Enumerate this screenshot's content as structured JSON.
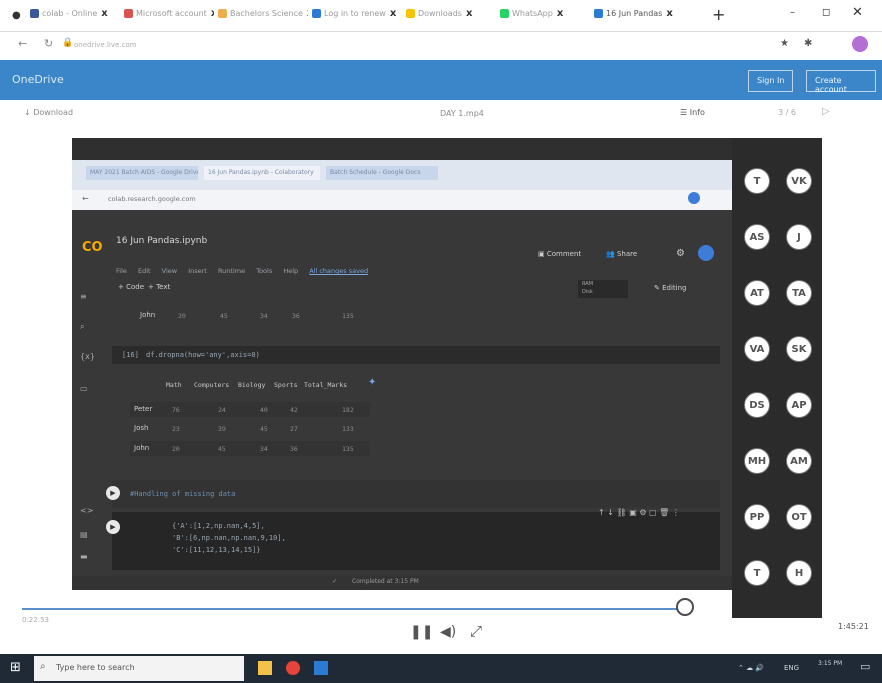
{
  "browser_tabs": [
    {
      "label": "colab - Online",
      "color": "#3b5998"
    },
    {
      "label": "Microsoft account",
      "color": "#d9534f"
    },
    {
      "label": "Bachelors Science",
      "color": "#f0ad4e"
    },
    {
      "label": "Log in to renew",
      "color": "#2b7bd3"
    },
    {
      "label": "Downloads",
      "color": "#f6c400"
    },
    {
      "label": "WhatsApp",
      "color": "#25d366"
    },
    {
      "label": "16 Jun Pandas",
      "color": "#2b7bd3"
    }
  ],
  "address": {
    "url": "onedrive.live.com"
  },
  "onedrive": {
    "title": "OneDrive",
    "sign_in": "Sign In",
    "create_account": "Create account"
  },
  "file_bar": {
    "download": "Download",
    "file_name": "DAY 1.mp4",
    "info": "Info",
    "page": "3 / 6"
  },
  "inner_browser": {
    "tabs": [
      "MAY 2021 Batch AIDS - Google Drive",
      "16 Jun Pandas.ipynb - Colaboratory",
      "Batch Schedule - Google Docs"
    ],
    "address": "colab.research.google.com"
  },
  "colab": {
    "logo": "CO",
    "notebook": "16 Jun Pandas.ipynb",
    "menu": [
      "File",
      "Edit",
      "View",
      "Insert",
      "Runtime",
      "Tools",
      "Help",
      "All changes saved"
    ],
    "add_code": "+ Code",
    "add_text": "+ Text",
    "comment": "Comment",
    "share": "Share",
    "editing": "Editing",
    "ram": "RAM",
    "disk": "Disk",
    "cell_in": "[16]",
    "cell_code": "df.dropna(how='any',axis=0)",
    "columns": [
      "Math",
      "Computers",
      "Biology",
      "Sports",
      "Total_Marks"
    ],
    "rows": [
      {
        "name": "Peter",
        "v": [
          "76",
          "24",
          "40",
          "42",
          "182"
        ]
      },
      {
        "name": "Josh",
        "v": [
          "23",
          "39",
          "45",
          "27",
          "133"
        ]
      },
      {
        "name": "John",
        "v": [
          "20",
          "45",
          "34",
          "36",
          "135"
        ]
      }
    ],
    "prev_row": {
      "name": "John",
      "v": [
        "20",
        "45",
        "34",
        "36",
        "135"
      ]
    },
    "markdown_cell": "#Handling of missing data",
    "code_cell": [
      "{'A':[1,2,np.nan,4,5],",
      " 'B':[6,np.nan,np.nan,9,10],",
      " 'C':[11,12,13,14,15]}"
    ],
    "status": "Completed at 3:15 PM"
  },
  "participants": [
    "T",
    "VK",
    "AS",
    "J",
    "AT",
    "TA",
    "VA",
    "SK",
    "DS",
    "AP",
    "MH",
    "AM",
    "PP",
    "OT",
    "T",
    "H"
  ],
  "player": {
    "time_left": "0:22:53",
    "time_right": "1:45:21"
  },
  "taskbar": {
    "search_placeholder": "Type here to search",
    "lang": "ENG",
    "time": "3:15 PM"
  }
}
